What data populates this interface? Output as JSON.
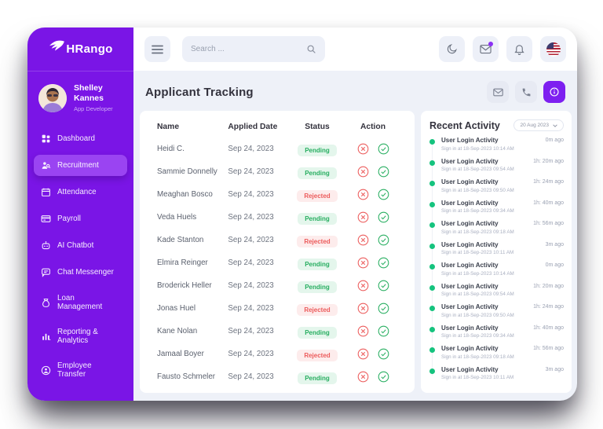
{
  "app": {
    "name": "HRango"
  },
  "colors": {
    "accent": "#7a15e6",
    "accent_active": "#9a44f2",
    "success": "#27ae60",
    "danger": "#ec5b5b",
    "activity_dot": "#15c37e"
  },
  "sidebar": {
    "logo": "HRango",
    "profile": {
      "name": "Shelley Kannes",
      "role": "App Developer"
    },
    "items": [
      {
        "label": "Dashboard",
        "icon": "dashboard-icon",
        "active": false
      },
      {
        "label": "Recruitment",
        "icon": "recruitment-icon",
        "active": true
      },
      {
        "label": "Attendance",
        "icon": "calendar-icon",
        "active": false
      },
      {
        "label": "Payroll",
        "icon": "card-icon",
        "active": false
      },
      {
        "label": "AI Chatbot",
        "icon": "robot-icon",
        "active": false
      },
      {
        "label": "Chat Messenger",
        "icon": "chat-icon",
        "active": false
      },
      {
        "label": "Loan Management",
        "icon": "money-bag-icon",
        "active": false
      },
      {
        "label": "Reporting & Analytics",
        "icon": "bar-chart-icon",
        "active": false
      },
      {
        "label": "Employee Transfer",
        "icon": "person-circle-icon",
        "active": false
      }
    ]
  },
  "topbar": {
    "search_placeholder": "Search ...",
    "icons": [
      "moon-icon",
      "mail-icon",
      "bell-icon",
      "us-flag-icon"
    ]
  },
  "page": {
    "title": "Applicant Tracking",
    "header_icons": [
      "mail-icon",
      "phone-icon",
      "info-icon"
    ]
  },
  "table": {
    "headers": [
      "Name",
      "Applied Date",
      "Status",
      "Action"
    ],
    "rows": [
      {
        "name": "Heidi C.",
        "date": "Sep 24, 2023",
        "status": "Pending"
      },
      {
        "name": "Sammie Donnelly",
        "date": "Sep 24, 2023",
        "status": "Pending"
      },
      {
        "name": "Meaghan Bosco",
        "date": "Sep 24, 2023",
        "status": "Rejected"
      },
      {
        "name": "Veda Huels",
        "date": "Sep 24, 2023",
        "status": "Pending"
      },
      {
        "name": "Kade Stanton",
        "date": "Sep 24, 2023",
        "status": "Rejected"
      },
      {
        "name": "Elmira Reinger",
        "date": "Sep 24, 2023",
        "status": "Pending"
      },
      {
        "name": "Broderick Heller",
        "date": "Sep 24, 2023",
        "status": "Pending"
      },
      {
        "name": "Jonas Huel",
        "date": "Sep 24, 2023",
        "status": "Rejected"
      },
      {
        "name": "Kane Nolan",
        "date": "Sep 24, 2023",
        "status": "Pending"
      },
      {
        "name": "Jamaal Boyer",
        "date": "Sep 24, 2023",
        "status": "Rejected"
      },
      {
        "name": "Fausto Schmeler",
        "date": "Sep 24, 2023",
        "status": "Pending"
      }
    ]
  },
  "activity": {
    "title": "Recent Activity",
    "filter": "20 Aug 2023",
    "items": [
      {
        "title": "User Login Activity",
        "subtitle": "Sign in at 18-Sep-2023 10:14 AM",
        "time": "0m ago"
      },
      {
        "title": "User Login Activity",
        "subtitle": "Sign in at 18-Sep-2023 09:54 AM",
        "time": "1h: 20m ago"
      },
      {
        "title": "User Login Activity",
        "subtitle": "Sign in at 18-Sep-2023 09:50 AM",
        "time": "1h: 24m ago"
      },
      {
        "title": "User Login Activity",
        "subtitle": "Sign in at 18-Sep-2023 09:34 AM",
        "time": "1h: 40m ago"
      },
      {
        "title": "User Login Activity",
        "subtitle": "Sign in at 18-Sep-2023 09:18 AM",
        "time": "1h: 56m ago"
      },
      {
        "title": "User Login Activity",
        "subtitle": "Sign in at 18-Sep-2023 10:11 AM",
        "time": "3m ago"
      },
      {
        "title": "User Login Activity",
        "subtitle": "Sign in at 18-Sep-2023 10:14 AM",
        "time": "0m ago"
      },
      {
        "title": "User Login Activity",
        "subtitle": "Sign in at 18-Sep-2023 09:54 AM",
        "time": "1h: 20m ago"
      },
      {
        "title": "User Login Activity",
        "subtitle": "Sign in at 18-Sep-2023 09:50 AM",
        "time": "1h: 24m ago"
      },
      {
        "title": "User Login Activity",
        "subtitle": "Sign in at 18-Sep-2023 09:34 AM",
        "time": "1h: 40m ago"
      },
      {
        "title": "User Login Activity",
        "subtitle": "Sign in at 18-Sep-2023 09:18 AM",
        "time": "1h: 56m ago"
      },
      {
        "title": "User Login Activity",
        "subtitle": "Sign in at 18-Sep-2023 10:11 AM",
        "time": "3m ago"
      }
    ]
  }
}
